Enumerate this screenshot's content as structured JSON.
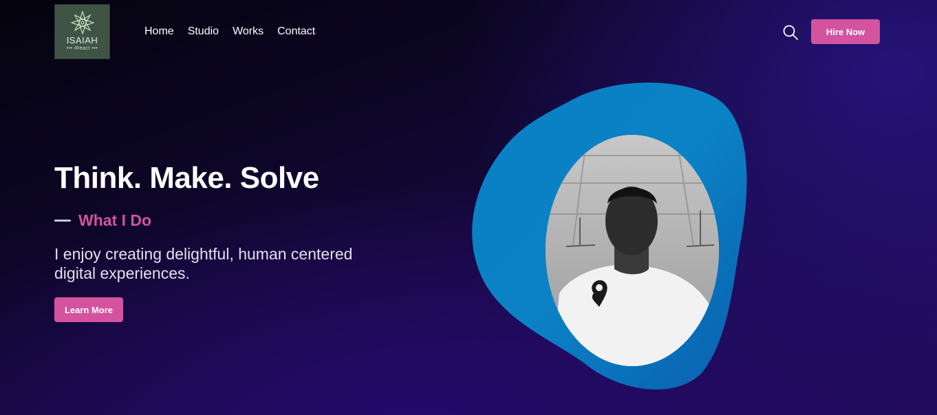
{
  "header": {
    "logo": {
      "name": "ISAIAH",
      "subtitle": "iReact"
    },
    "nav": [
      {
        "label": "Home"
      },
      {
        "label": "Studio"
      },
      {
        "label": "Works"
      },
      {
        "label": "Contact"
      }
    ],
    "search_icon": "search-icon",
    "hire_button": "Hire Now"
  },
  "hero": {
    "title": "Think. Make. Solve",
    "subtitle": "What I Do",
    "description": "I enjoy creating delightful, human centered digital experiences.",
    "cta_button": "Learn More",
    "image_alt": "profile photo"
  },
  "colors": {
    "accent": "#d3539f",
    "blob": "#0a7fc4",
    "background_dark": "#0c0624",
    "background_purple": "#230c5e"
  }
}
